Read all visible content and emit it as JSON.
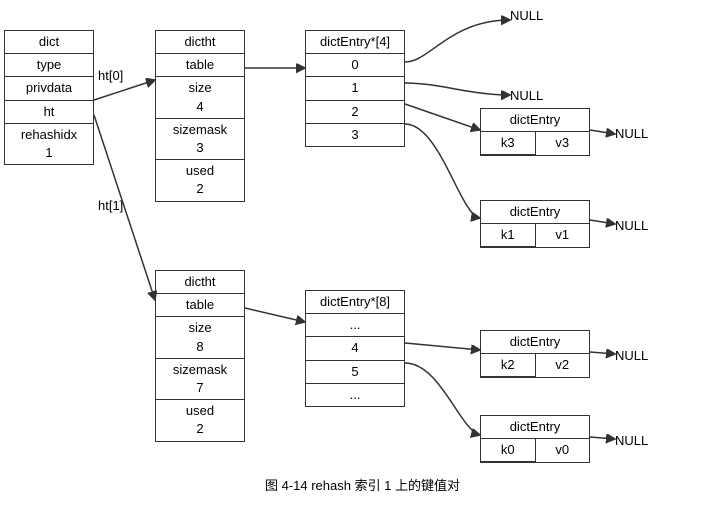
{
  "title": "图 4-14   rehash 索引 1 上的键值对",
  "dict_box": {
    "header": "dict",
    "cells": [
      "type",
      "privdata",
      "ht",
      "rehashidx\n1"
    ]
  },
  "ht0_label": "ht[0]",
  "ht1_label": "ht[1]",
  "dictht0": {
    "header": "dictht",
    "cells": [
      "table",
      "size\n4",
      "sizemask\n3",
      "used\n2"
    ]
  },
  "dictht1": {
    "header": "dictht",
    "cells": [
      "table",
      "size\n8",
      "sizemask\n7",
      "used\n2"
    ]
  },
  "entry_array0": {
    "header": "dictEntry*[4]",
    "cells": [
      "0",
      "1",
      "2",
      "3"
    ]
  },
  "entry_array1": {
    "header": "dictEntry*[8]",
    "cells": [
      "...",
      "4",
      "5",
      "..."
    ]
  },
  "entry_k3v3": {
    "label": "dictEntry",
    "k": "k3",
    "v": "v3"
  },
  "entry_k1v1": {
    "label": "dictEntry",
    "k": "k1",
    "v": "v1"
  },
  "entry_k2v2": {
    "label": "dictEntry",
    "k": "k2",
    "v": "v2"
  },
  "entry_k0v0": {
    "label": "dictEntry",
    "k": "k0",
    "v": "v0"
  },
  "null_labels": [
    "NULL",
    "NULL",
    "NULL",
    "NULL",
    "NULL",
    "NULL"
  ]
}
